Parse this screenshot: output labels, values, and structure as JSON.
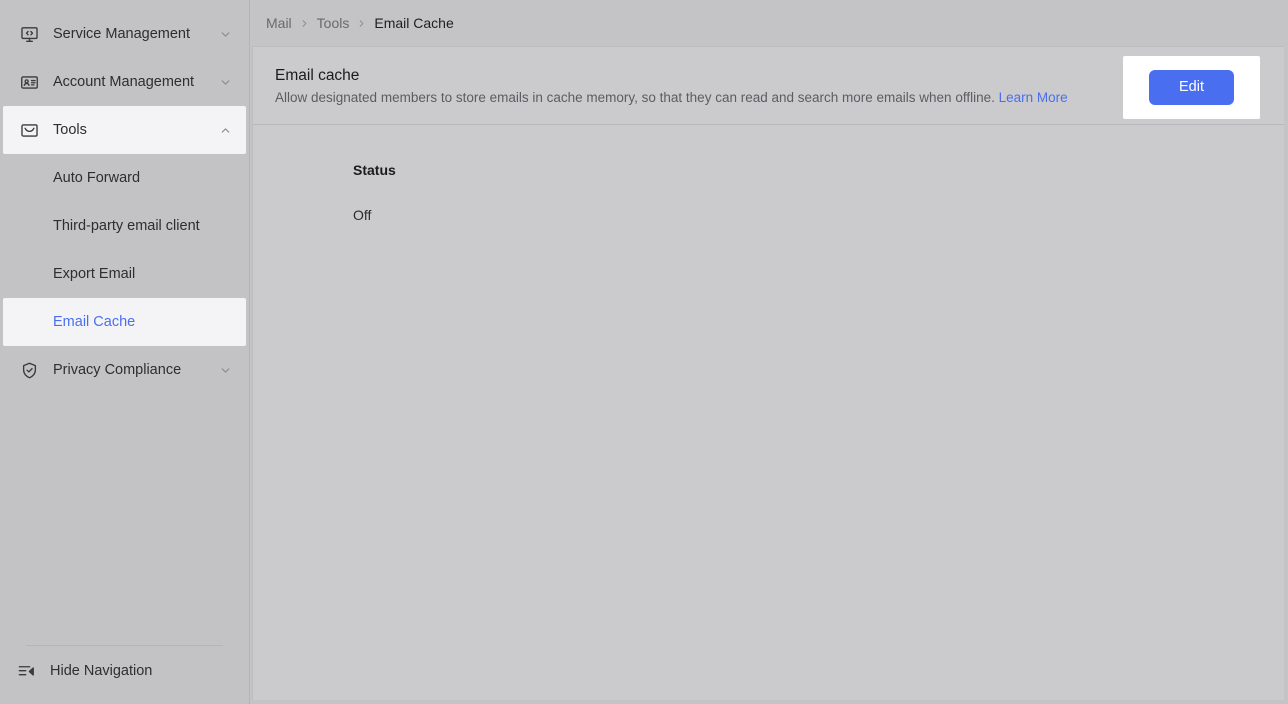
{
  "sidebar": {
    "groups": [
      {
        "label": "Service Management",
        "icon": "monitor-code-icon",
        "chevron": "chevron-down-icon",
        "expanded": false,
        "children": []
      },
      {
        "label": "Account Management",
        "icon": "id-card-icon",
        "chevron": "chevron-down-icon",
        "expanded": false,
        "children": []
      },
      {
        "label": "Tools",
        "icon": "envelope-icon",
        "chevron": "chevron-up-icon",
        "expanded": true,
        "children": [
          {
            "label": "Auto Forward",
            "active": false
          },
          {
            "label": "Third-party email client",
            "active": false
          },
          {
            "label": "Export Email",
            "active": false
          },
          {
            "label": "Email Cache",
            "active": true
          }
        ]
      },
      {
        "label": "Privacy Compliance",
        "icon": "shield-check-icon",
        "chevron": "chevron-down-icon",
        "expanded": false,
        "children": []
      }
    ],
    "footer": {
      "label": "Hide Navigation",
      "icon": "hide-navigation-icon"
    }
  },
  "breadcrumb": {
    "items": [
      "Mail",
      "Tools",
      "Email Cache"
    ],
    "separator": "chevron-right-icon"
  },
  "panel": {
    "title": "Email cache",
    "description": "Allow designated members to store emails in cache memory, so that they can read and search more emails when offline.",
    "link_label": "Learn More",
    "edit_label": "Edit",
    "status_label": "Status",
    "status_value": "Off"
  },
  "colors": {
    "accent": "#4a6ef0",
    "sidebar_bg": "#c3c3c5",
    "panel_bg": "#cbcbcd",
    "page_bg": "#c4c4c6",
    "active_item_bg": "#f4f4f6",
    "text_primary": "#1b1b1d",
    "text_muted": "#6a6a6e"
  }
}
